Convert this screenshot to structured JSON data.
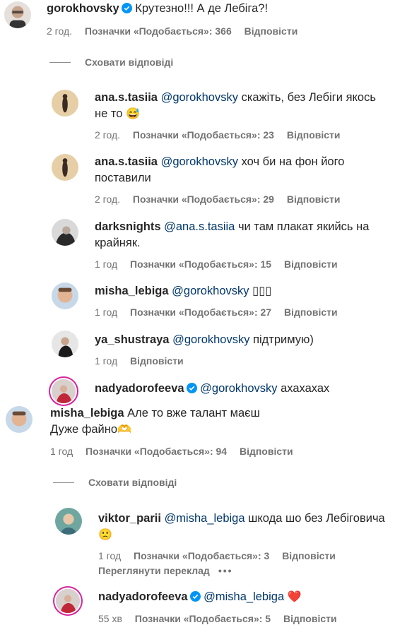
{
  "colors": {
    "text": "#262626",
    "meta": "#737373",
    "mention": "#00376b",
    "verified": "#0095f6",
    "story_ring": "#d6249f"
  },
  "comments": [
    {
      "user": "gorokhovsky",
      "verified": true,
      "mention": "",
      "text": "Крутезно!!! А де Лебіга?!",
      "time": "2 год.",
      "likes": "Позначки «Подобається»: 366",
      "reply": "Відповісти"
    },
    {
      "user": "ana.s.tasiia",
      "verified": false,
      "mention": "@gorokhovsky",
      "text": "скажіть, без Лебіги якось не то",
      "emoji": "😅",
      "time": "2 год.",
      "likes": "Позначки «Подобається»: 23",
      "reply": "Відповісти"
    },
    {
      "user": "ana.s.tasiia",
      "verified": false,
      "mention": "@gorokhovsky",
      "text": "хоч би на фон його поставили",
      "time": "2 год.",
      "likes": "Позначки «Подобається»: 29",
      "reply": "Відповісти"
    },
    {
      "user": "darksnights",
      "verified": false,
      "mention": "@ana.s.tasiia",
      "text": "чи там плакат якийсь на крайняк.",
      "time": "1 год",
      "likes": "Позначки «Подобається»: 15",
      "reply": "Відповісти"
    },
    {
      "user": "misha_lebiga",
      "verified": false,
      "mention": "@gorokhovsky",
      "text": "▯▯▯",
      "time": "1 год",
      "likes": "Позначки «Подобається»: 27",
      "reply": "Відповісти"
    },
    {
      "user": "ya_shustraya",
      "verified": false,
      "mention": "@gorokhovsky",
      "text": "підтримую)",
      "time": "1 год",
      "likes": "",
      "reply": "Відповісти"
    },
    {
      "user": "nadyadorofeeva",
      "verified": true,
      "mention": "@gorokhovsky",
      "text": "ахахахах"
    },
    {
      "user": "misha_lebiga",
      "verified": false,
      "mention": "",
      "text": "Але то вже талант маєш",
      "text2": "Дуже файно",
      "emoji": "🫶",
      "time": "1 год",
      "likes": "Позначки «Подобається»: 94",
      "reply": "Відповісти"
    },
    {
      "user": "viktor_parii",
      "verified": false,
      "mention": "@misha_lebiga",
      "text": "шкода шо без Лебіговича",
      "emoji": "🙁",
      "time": "1 год",
      "likes": "Позначки «Подобається»: 3",
      "reply": "Відповісти",
      "translate": "Переглянути переклад",
      "more": "•••"
    },
    {
      "user": "nadyadorofeeva",
      "verified": true,
      "mention": "@misha_lebiga",
      "text": "",
      "emoji": "❤️",
      "time": "55 хв",
      "likes": "Позначки «Подобається»: 5",
      "reply": "Відповісти"
    }
  ],
  "hide_replies_1": "Сховати відповіді",
  "hide_replies_2": "Сховати відповіді"
}
